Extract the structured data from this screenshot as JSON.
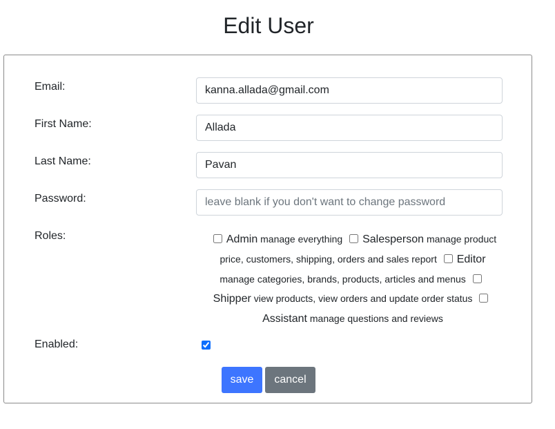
{
  "page": {
    "title": "Edit User"
  },
  "form": {
    "email": {
      "label": "Email:",
      "value": "kanna.allada@gmail.com"
    },
    "first_name": {
      "label": "First Name:",
      "value": "Allada"
    },
    "last_name": {
      "label": "Last Name:",
      "value": "Pavan"
    },
    "password": {
      "label": "Password:",
      "value": "",
      "placeholder": "leave blank if you don't want to change password"
    },
    "roles": {
      "label": "Roles:",
      "items": [
        {
          "name": "Admin",
          "description": "manage everything",
          "checked": false
        },
        {
          "name": "Salesperson",
          "description": "manage product price, customers, shipping, orders and sales report",
          "checked": false
        },
        {
          "name": "Editor",
          "description": "manage categories, brands, products, articles and menus",
          "checked": false
        },
        {
          "name": "Shipper",
          "description": "view products, view orders and update order status",
          "checked": false
        },
        {
          "name": "Assistant",
          "description": "manage questions and reviews",
          "checked": false
        }
      ]
    },
    "enabled": {
      "label": "Enabled:",
      "checked": true
    }
  },
  "buttons": {
    "save_label": "save",
    "cancel_label": "cancel"
  },
  "colors": {
    "primary": "#3d75ff",
    "secondary": "#6c757d",
    "border": "#ced4da"
  }
}
